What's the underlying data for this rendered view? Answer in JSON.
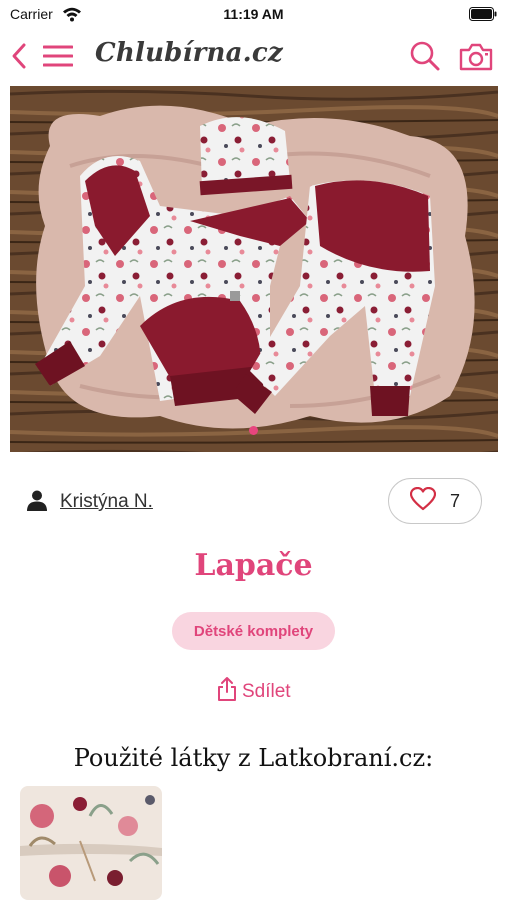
{
  "status_bar": {
    "carrier": "Carrier",
    "time": "11:19 AM"
  },
  "nav": {
    "brand": "Chlubírna.cz",
    "icons": [
      "back-chevron-icon",
      "hamburger-menu-icon",
      "search-icon",
      "camera-icon"
    ]
  },
  "gallery": {
    "page_count": 1,
    "active_page": 1
  },
  "post": {
    "author": "Kristýna N.",
    "likes": "7",
    "title": "Lapače",
    "category": "Dětské komplety",
    "share_label": "Sdílet"
  },
  "fabrics": {
    "heading": "Použité látky z Latkobraní.cz:"
  },
  "colors": {
    "accent": "#e0457b",
    "category_bg": "#f9d5e0",
    "dot": "#e8457e"
  }
}
